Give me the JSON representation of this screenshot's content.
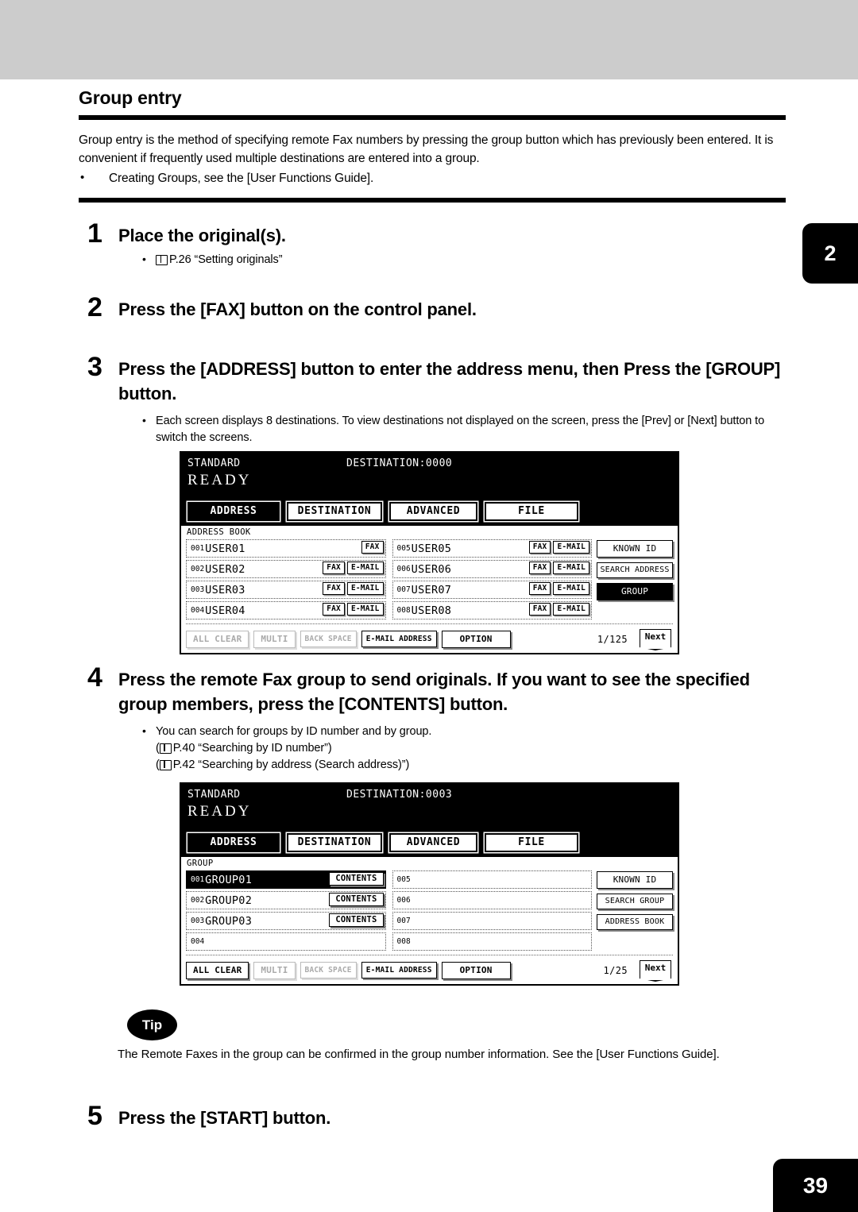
{
  "chapter_tab": "2",
  "page_number": "39",
  "section": {
    "title": "Group entry",
    "intro": "Group entry is the method of specifying remote Fax numbers by pressing the group button which has previously been entered. It is convenient if frequently used multiple destinations are entered into a group.",
    "bullets": [
      "Creating Groups, see the [User Functions Guide]."
    ]
  },
  "steps": {
    "s1": {
      "num": "1",
      "title": "Place the original(s).",
      "ref": "P.26 “Setting originals”"
    },
    "s2": {
      "num": "2",
      "title": "Press the [FAX] button on the control panel."
    },
    "s3": {
      "num": "3",
      "title": "Press the [ADDRESS] button to enter the address menu, then Press the [GROUP] button.",
      "note": "Each screen displays 8 destinations. To view destinations not displayed on the screen, press the [Prev] or [Next] button to switch the screens."
    },
    "s4": {
      "num": "4",
      "title": "Press the remote Fax group to send originals. If you want to see the specified group members, press the [CONTENTS] button.",
      "note": "You can search for groups by ID number and by group.",
      "ref1": "P.40 “Searching by ID number”",
      "ref2": "P.42 “Searching by address (Search address)”"
    },
    "s5": {
      "num": "5",
      "title": "Press the [START] button."
    }
  },
  "tip": {
    "badge": "Tip",
    "text": "The Remote Faxes in the group can be confirmed in the group number information. See the [User Functions Guide]."
  },
  "lcd1": {
    "status_mode": "STANDARD",
    "status_destination": "DESTINATION:0000",
    "ready": "READY",
    "tabs": [
      {
        "label": "ADDRESS",
        "selected": true
      },
      {
        "label": "DESTINATION",
        "selected": false
      },
      {
        "label": "ADVANCED",
        "selected": false
      },
      {
        "label": "FILE",
        "selected": false
      }
    ],
    "list_label": "ADDRESS BOOK",
    "col_left": [
      {
        "num": "001",
        "name": "USER01",
        "actions": [
          "FAX"
        ],
        "selected": false
      },
      {
        "num": "002",
        "name": "USER02",
        "actions": [
          "FAX",
          "E-MAIL"
        ],
        "selected": false
      },
      {
        "num": "003",
        "name": "USER03",
        "actions": [
          "FAX",
          "E-MAIL"
        ],
        "selected": false
      },
      {
        "num": "004",
        "name": "USER04",
        "actions": [
          "FAX",
          "E-MAIL"
        ],
        "selected": false
      }
    ],
    "col_right": [
      {
        "num": "005",
        "name": "USER05",
        "actions": [
          "FAX",
          "E-MAIL"
        ],
        "selected": false
      },
      {
        "num": "006",
        "name": "USER06",
        "actions": [
          "FAX",
          "E-MAIL"
        ],
        "selected": false
      },
      {
        "num": "007",
        "name": "USER07",
        "actions": [
          "FAX",
          "E-MAIL"
        ],
        "selected": false
      },
      {
        "num": "008",
        "name": "USER08",
        "actions": [
          "FAX",
          "E-MAIL"
        ],
        "selected": false
      }
    ],
    "side_buttons": [
      {
        "label": "KNOWN ID",
        "selected": false
      },
      {
        "label": "SEARCH ADDRESS",
        "selected": false
      },
      {
        "label": "GROUP",
        "selected": true
      }
    ],
    "footer": {
      "all_clear": "ALL CLEAR",
      "all_clear_enabled": false,
      "multi": "MULTI",
      "multi_enabled": false,
      "back_space": "BACK SPACE",
      "back_space_enabled": false,
      "email_address": "E-MAIL ADDRESS",
      "option": "OPTION",
      "page_count": "1/125",
      "next": "Next"
    }
  },
  "lcd2": {
    "status_mode": "STANDARD",
    "status_destination": "DESTINATION:0003",
    "ready": "READY",
    "tabs": [
      {
        "label": "ADDRESS",
        "selected": true
      },
      {
        "label": "DESTINATION",
        "selected": false
      },
      {
        "label": "ADVANCED",
        "selected": false
      },
      {
        "label": "FILE",
        "selected": false
      }
    ],
    "list_label": "GROUP",
    "col_left": [
      {
        "num": "001",
        "name": "GROUP01",
        "actions": [
          "CONTENTS"
        ],
        "selected": true
      },
      {
        "num": "002",
        "name": "GROUP02",
        "actions": [
          "CONTENTS"
        ],
        "selected": false
      },
      {
        "num": "003",
        "name": "GROUP03",
        "actions": [
          "CONTENTS"
        ],
        "selected": false
      },
      {
        "num": "004",
        "name": "",
        "actions": [],
        "selected": false
      }
    ],
    "col_right": [
      {
        "num": "005",
        "name": "",
        "actions": [],
        "selected": false
      },
      {
        "num": "006",
        "name": "",
        "actions": [],
        "selected": false
      },
      {
        "num": "007",
        "name": "",
        "actions": [],
        "selected": false
      },
      {
        "num": "008",
        "name": "",
        "actions": [],
        "selected": false
      }
    ],
    "side_buttons": [
      {
        "label": "KNOWN ID",
        "selected": false
      },
      {
        "label": "SEARCH GROUP",
        "selected": false
      },
      {
        "label": "ADDRESS BOOK",
        "selected": false
      }
    ],
    "footer": {
      "all_clear": "ALL CLEAR",
      "all_clear_enabled": true,
      "multi": "MULTI",
      "multi_enabled": false,
      "back_space": "BACK SPACE",
      "back_space_enabled": false,
      "email_address": "E-MAIL ADDRESS",
      "option": "OPTION",
      "page_count": "1/25",
      "next": "Next"
    }
  }
}
